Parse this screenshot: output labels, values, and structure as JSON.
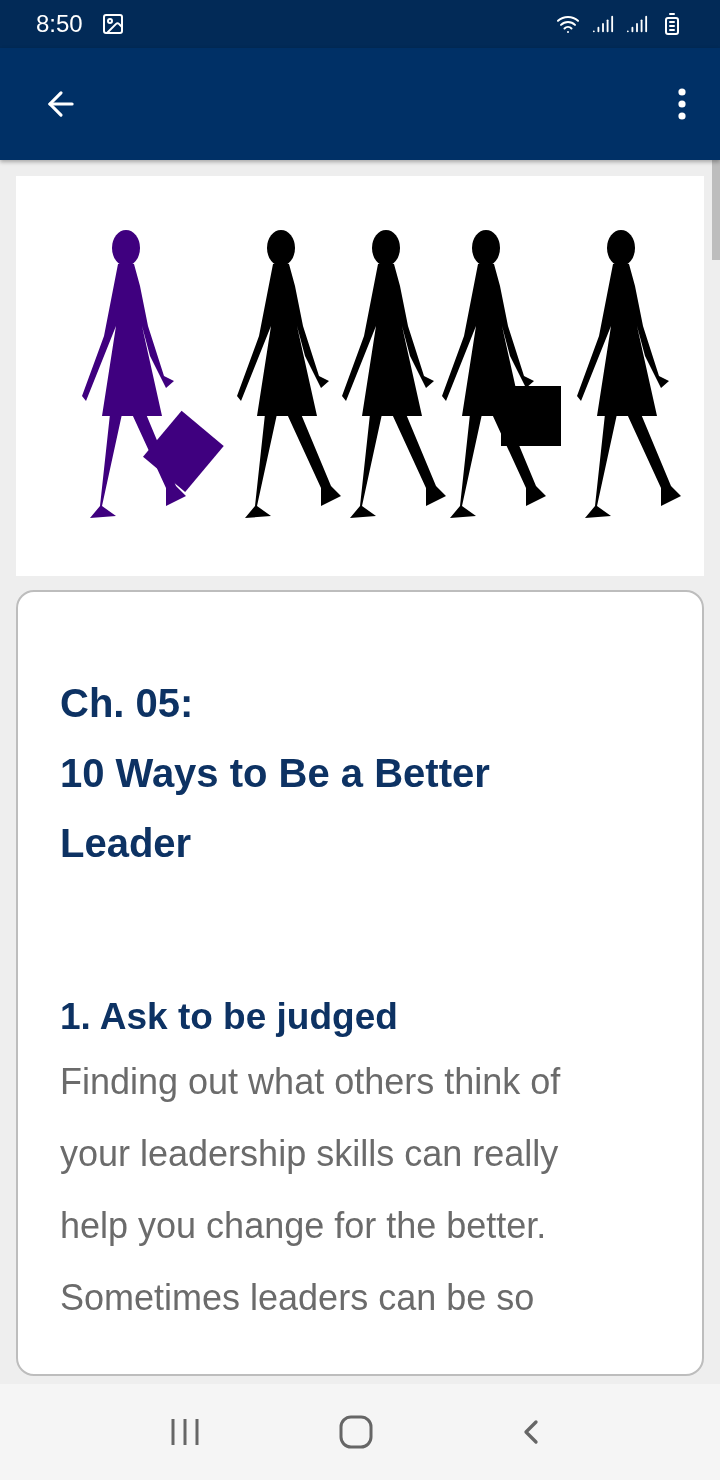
{
  "status_bar": {
    "time": "8:50"
  },
  "article": {
    "chapter": "Ch. 05:",
    "title": "10 Ways to Be a Better Leader",
    "sections": [
      {
        "heading": "1. Ask to be judged",
        "body": "Finding out what others think of your leadership skills can really help you change for the better. Sometimes leaders can be so"
      }
    ]
  }
}
